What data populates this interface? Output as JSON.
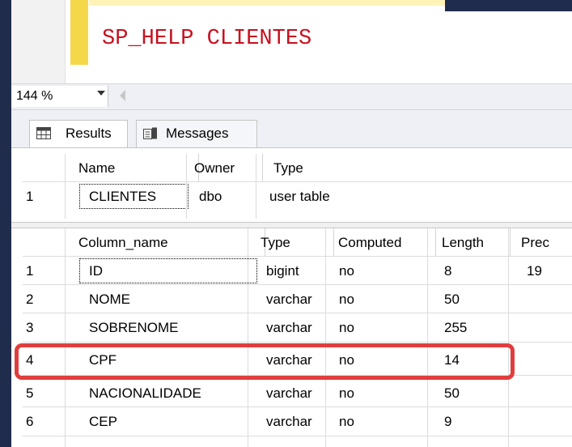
{
  "editor": {
    "code_line": "SP_HELP CLIENTES"
  },
  "zoom": {
    "value": "144 %"
  },
  "tabs": [
    {
      "label": "Results",
      "icon": "grid-icon"
    },
    {
      "label": "Messages",
      "icon": "messages-icon"
    }
  ],
  "table_info": {
    "headers": [
      "Name",
      "Owner",
      "Type"
    ],
    "rows": [
      {
        "num": "1",
        "cells": [
          "CLIENTES",
          "dbo",
          "user table"
        ]
      }
    ]
  },
  "columns_info": {
    "headers": [
      "Column_name",
      "Type",
      "Computed",
      "Length",
      "Prec"
    ],
    "rows": [
      {
        "num": "1",
        "cells": [
          "ID",
          "bigint",
          "no",
          "8",
          "19"
        ]
      },
      {
        "num": "2",
        "cells": [
          "NOME",
          "varchar",
          "no",
          "50",
          ""
        ]
      },
      {
        "num": "3",
        "cells": [
          "SOBRENOME",
          "varchar",
          "no",
          "255",
          ""
        ]
      },
      {
        "num": "4",
        "cells": [
          "CPF",
          "varchar",
          "no",
          "14",
          ""
        ]
      },
      {
        "num": "5",
        "cells": [
          "NACIONALIDADE",
          "varchar",
          "no",
          "50",
          ""
        ]
      },
      {
        "num": "6",
        "cells": [
          "CEP",
          "varchar",
          "no",
          "9",
          ""
        ]
      }
    ]
  },
  "highlight": {
    "row": "4",
    "color": "#e03e3e"
  }
}
